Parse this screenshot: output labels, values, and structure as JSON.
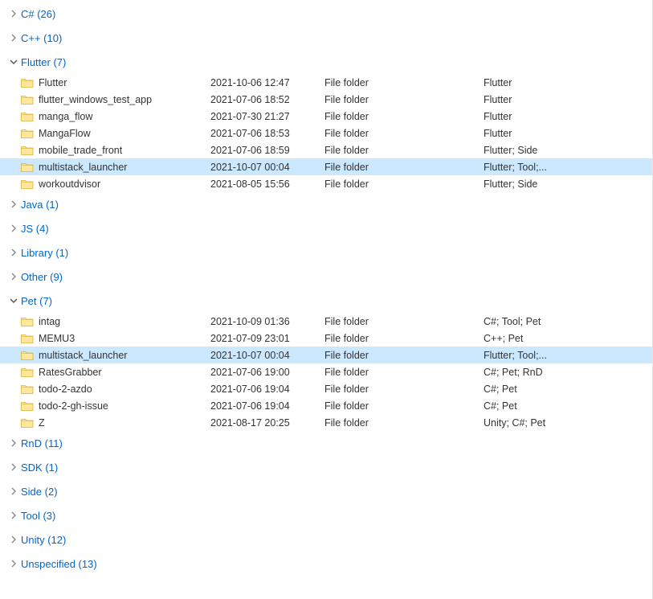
{
  "groups": [
    {
      "id": "csharp",
      "label": "C# (26)",
      "expanded": false,
      "items": []
    },
    {
      "id": "cpp",
      "label": "C++ (10)",
      "expanded": false,
      "items": []
    },
    {
      "id": "flutter",
      "label": "Flutter (7)",
      "expanded": true,
      "items": [
        {
          "name": "Flutter",
          "date": "2021-10-06 12:47",
          "type": "File folder",
          "tags": "Flutter",
          "selected": false
        },
        {
          "name": "flutter_windows_test_app",
          "date": "2021-07-06 18:52",
          "type": "File folder",
          "tags": "Flutter",
          "selected": false
        },
        {
          "name": "manga_flow",
          "date": "2021-07-30 21:27",
          "type": "File folder",
          "tags": "Flutter",
          "selected": false
        },
        {
          "name": "MangaFlow",
          "date": "2021-07-06 18:53",
          "type": "File folder",
          "tags": "Flutter",
          "selected": false
        },
        {
          "name": "mobile_trade_front",
          "date": "2021-07-06 18:59",
          "type": "File folder",
          "tags": "Flutter; Side",
          "selected": false
        },
        {
          "name": "multistack_launcher",
          "date": "2021-10-07 00:04",
          "type": "File folder",
          "tags": "Flutter; Tool;...",
          "selected": true
        },
        {
          "name": "workoutdvisor",
          "date": "2021-08-05 15:56",
          "type": "File folder",
          "tags": "Flutter; Side",
          "selected": false
        }
      ]
    },
    {
      "id": "java",
      "label": "Java (1)",
      "expanded": false,
      "items": []
    },
    {
      "id": "js",
      "label": "JS (4)",
      "expanded": false,
      "items": []
    },
    {
      "id": "library",
      "label": "Library (1)",
      "expanded": false,
      "items": []
    },
    {
      "id": "other",
      "label": "Other (9)",
      "expanded": false,
      "items": []
    },
    {
      "id": "pet",
      "label": "Pet (7)",
      "expanded": true,
      "items": [
        {
          "name": "intag",
          "date": "2021-10-09 01:36",
          "type": "File folder",
          "tags": "C#; Tool; Pet",
          "selected": false
        },
        {
          "name": "MEMU3",
          "date": "2021-07-09 23:01",
          "type": "File folder",
          "tags": "C++; Pet",
          "selected": false
        },
        {
          "name": "multistack_launcher",
          "date": "2021-10-07 00:04",
          "type": "File folder",
          "tags": "Flutter; Tool;...",
          "selected": true
        },
        {
          "name": "RatesGrabber",
          "date": "2021-07-06 19:00",
          "type": "File folder",
          "tags": "C#; Pet; RnD",
          "selected": false
        },
        {
          "name": "todo-2-azdo",
          "date": "2021-07-06 19:04",
          "type": "File folder",
          "tags": "C#; Pet",
          "selected": false
        },
        {
          "name": "todo-2-gh-issue",
          "date": "2021-07-06 19:04",
          "type": "File folder",
          "tags": "C#; Pet",
          "selected": false
        },
        {
          "name": "Z",
          "date": "2021-08-17 20:25",
          "type": "File folder",
          "tags": "Unity; C#; Pet",
          "selected": false
        }
      ]
    },
    {
      "id": "rnd",
      "label": "RnD (11)",
      "expanded": false,
      "items": []
    },
    {
      "id": "sdk",
      "label": "SDK (1)",
      "expanded": false,
      "items": []
    },
    {
      "id": "side",
      "label": "Side (2)",
      "expanded": false,
      "items": []
    },
    {
      "id": "tool",
      "label": "Tool (3)",
      "expanded": false,
      "items": []
    },
    {
      "id": "unity",
      "label": "Unity (12)",
      "expanded": false,
      "items": []
    },
    {
      "id": "unspecified",
      "label": "Unspecified (13)",
      "expanded": false,
      "items": []
    }
  ]
}
